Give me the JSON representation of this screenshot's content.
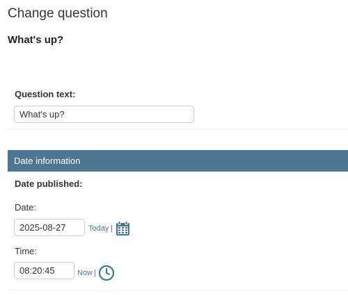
{
  "page": {
    "title": "Change question",
    "object_title": "What's up?"
  },
  "question_text": {
    "label": "Question text:",
    "value": "What's up?"
  },
  "date_information": {
    "header": "Date information",
    "date_published_label": "Date published:",
    "date": {
      "label": "Date:",
      "value": "2025-08-27",
      "shortcut": "Today",
      "separator": "|",
      "icon": "calendar-icon"
    },
    "time": {
      "label": "Time:",
      "value": "08:20:45",
      "shortcut": "Now",
      "separator": "|",
      "icon": "clock-icon"
    }
  },
  "colors": {
    "header_bg": "#4f7690",
    "link": "#447e9b",
    "icon": "#417690"
  }
}
